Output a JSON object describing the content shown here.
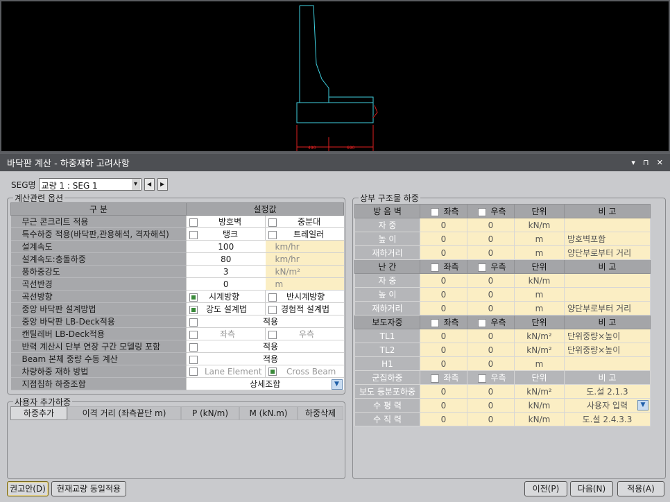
{
  "cad": {
    "dim_left": "490",
    "dim_right": "690"
  },
  "window": {
    "title": "바닥판 계산 - 하중재하 고려사항",
    "ctrl_menu": "▾",
    "ctrl_pin": "⊓",
    "ctrl_close": "✕"
  },
  "seg": {
    "label": "SEG명",
    "value": "교량 1 : SEG 1",
    "prev": "◀",
    "next": "▶"
  },
  "calc": {
    "group_label": "계산관련 옵션",
    "col1": "구 분",
    "col2": "설정값",
    "rows": {
      "r1": {
        "label": "무근 콘크리트 적용",
        "a": "방호벽",
        "b": "중분대"
      },
      "r2": {
        "label": "특수하중 적용(바닥판,관용해석, 격자해석)",
        "a": "탱크",
        "b": "트레일러"
      },
      "r3": {
        "label": "설계속도",
        "value": "100",
        "unit": "km/hr"
      },
      "r4": {
        "label": "설계속도:충돌하중",
        "value": "80",
        "unit": "km/hr"
      },
      "r5": {
        "label": "풍하중강도",
        "value": "3",
        "unit": "kN/m²"
      },
      "r6": {
        "label": "곡선반경",
        "value": "0",
        "unit": "m"
      },
      "r7": {
        "label": "곡선방향",
        "a": "시계방향",
        "b": "반시계방향"
      },
      "r8": {
        "label": "중앙 바닥판 설계방법",
        "a": "강도 설계법",
        "b": "경험적 설계법"
      },
      "r9": {
        "label": "중앙 바닥판 LB-Deck적용",
        "value": "적용"
      },
      "r10": {
        "label": "캔틸레버 LB-Deck적용",
        "a": "좌측",
        "b": "우측"
      },
      "r11": {
        "label": "반력 계산시 단부 연장 구간 모델링 포함",
        "value": "적용"
      },
      "r12": {
        "label": "Beam 본체 중량 수동 계산",
        "value": "적용"
      },
      "r13": {
        "label": "차량하중 재하 방법",
        "a": "Lane Element",
        "b": "Cross Beam"
      },
      "r14": {
        "label": "지점침하 하중조합",
        "value": "상세조합"
      }
    }
  },
  "user": {
    "group_label": "사용자 추가하중",
    "cols": [
      "하중추가",
      "이격 거리 (좌측끝단 m)",
      "P (kN/m)",
      "M (kN.m)",
      "하중삭제"
    ]
  },
  "upper": {
    "group_label": "상부 구조물 하중",
    "sec1": {
      "title": "방 음 벽",
      "left": "좌측",
      "right": "우측",
      "unit": "단위",
      "remark": "비 고"
    },
    "sec1_rows": [
      {
        "label": "자 중",
        "l": "0",
        "r": "0",
        "u": "kN/m",
        "note": ""
      },
      {
        "label": "높 이",
        "l": "0",
        "r": "0",
        "u": "m",
        "note": "방호벽포함"
      },
      {
        "label": "재하거리",
        "l": "0",
        "r": "0",
        "u": "m",
        "note": "양단부로부터 거리"
      }
    ],
    "sec2": {
      "title": "난 간",
      "left": "좌측",
      "right": "우측",
      "unit": "단위",
      "remark": "비 고"
    },
    "sec2_rows": [
      {
        "label": "자 중",
        "l": "0",
        "r": "0",
        "u": "kN/m",
        "note": ""
      },
      {
        "label": "높 이",
        "l": "0",
        "r": "0",
        "u": "m",
        "note": ""
      },
      {
        "label": "재하거리",
        "l": "0",
        "r": "0",
        "u": "m",
        "note": "양단부로부터 거리"
      }
    ],
    "sec3": {
      "title": "보도자중",
      "left": "좌측",
      "right": "우측",
      "unit": "단위",
      "remark": "비 고"
    },
    "sec3_rows": [
      {
        "label": "TL1",
        "l": "0",
        "r": "0",
        "u": "kN/m²",
        "note": "단위중량×높이"
      },
      {
        "label": "TL2",
        "l": "0",
        "r": "0",
        "u": "kN/m²",
        "note": "단위중량×높이"
      },
      {
        "label": "H1",
        "l": "0",
        "r": "0",
        "u": "m",
        "note": ""
      }
    ],
    "sec4": {
      "title": "군집하중",
      "left": "좌측",
      "right": "우측",
      "unit": "단위",
      "remark": "비 고"
    },
    "sec4_rows": [
      {
        "label": "보도 등분포하중",
        "l": "0",
        "r": "0",
        "u": "kN/m²",
        "note": "도.설 2.1.3"
      },
      {
        "label": "수 평 력",
        "l": "0",
        "r": "0",
        "u": "kN/m",
        "note": "사용자 입력"
      },
      {
        "label": "수 직 력",
        "l": "0",
        "r": "0",
        "u": "kN/m",
        "note": "도.설 2.4.3.3"
      }
    ]
  },
  "buttons": {
    "recommend": "권고안(D)",
    "same": "현재교량 동일적용",
    "prev": "이전(P)",
    "next": "다음(N)",
    "apply": "적용(A)"
  },
  "colors": {
    "cad_line": "#3fd1e0",
    "dim_line": "#e02020",
    "cell_yellow": "#fbeec4"
  }
}
